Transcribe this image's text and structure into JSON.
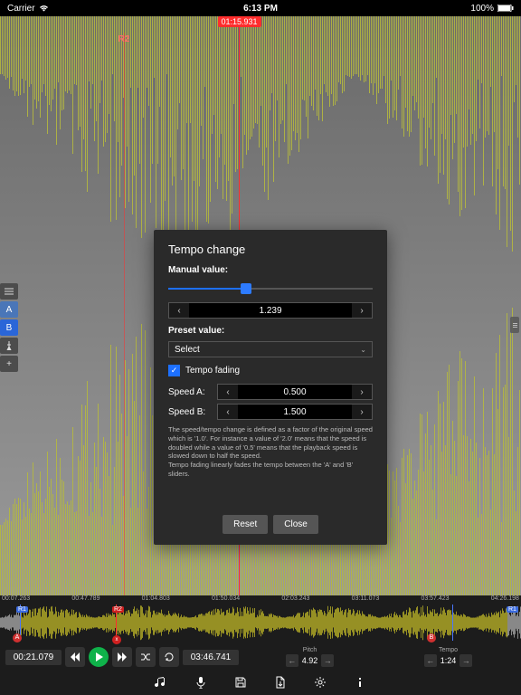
{
  "status": {
    "carrier": "Carrier",
    "time": "6:13 PM",
    "battery": "100%"
  },
  "playhead_time": "01:15.931",
  "markers": {
    "r2": "R2"
  },
  "side": {
    "a": "A",
    "b": "B"
  },
  "modal": {
    "title": "Tempo change",
    "manual_label": "Manual value:",
    "manual_value": "1.239",
    "preset_label": "Preset value:",
    "preset_value": "Select",
    "fading_label": "Tempo fading",
    "speed_a_label": "Speed A:",
    "speed_a": "0.500",
    "speed_b_label": "Speed B:",
    "speed_b": "1.500",
    "help": "The speed/tempo change is defined as a factor of the original speed which is '1.0'. For instance a value of '2.0' means that the speed is doubled while a value of '0.5' means that the playback speed is slowed down to half the speed.\nTempo fading linearly fades the tempo between the 'A' and 'B' sliders.",
    "reset": "Reset",
    "close": "Close"
  },
  "overview_times": [
    "00:07.263",
    "00:47.789",
    "01:04.803",
    "01:50.034",
    "02:03.243",
    "03:11.073",
    "03:57.423",
    "04:26.198"
  ],
  "overview_badges": {
    "r1_left": "R1",
    "a": "A",
    "r2": "R2",
    "b": "B",
    "r1_right": "R1"
  },
  "transport": {
    "pos": "00:21.079",
    "total": "03:46.741",
    "pitch_label": "Pitch",
    "pitch": "4.92",
    "tempo_label": "Tempo",
    "tempo": "1:24"
  }
}
